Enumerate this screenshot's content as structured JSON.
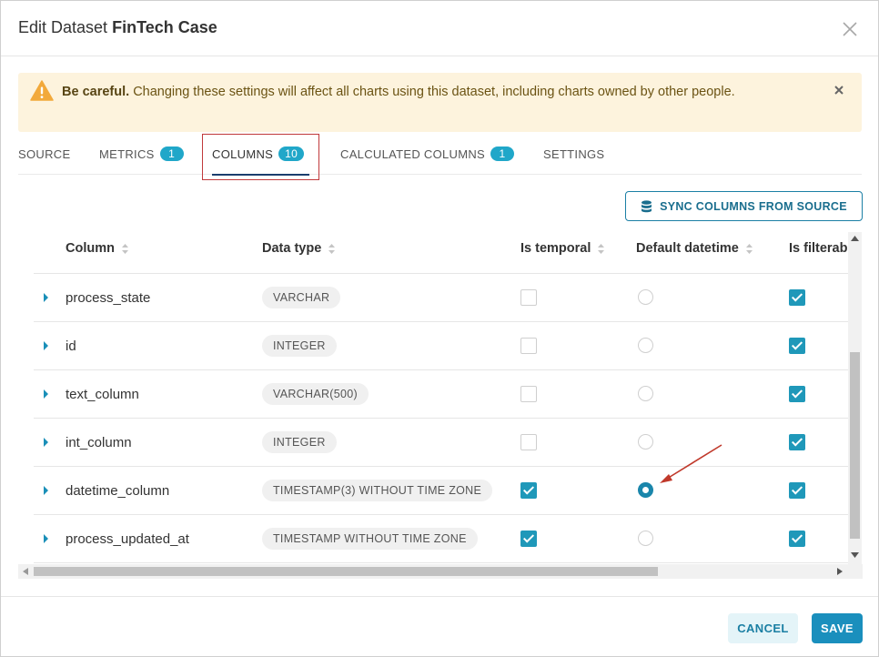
{
  "modal": {
    "title_prefix": "Edit Dataset",
    "title_name": "FinTech Case"
  },
  "alert": {
    "bold": "Be careful.",
    "message": "Changing these settings will affect all charts using this dataset, including charts owned by other people."
  },
  "tabs": [
    {
      "label": "SOURCE",
      "badge": ""
    },
    {
      "label": "METRICS",
      "badge": "1"
    },
    {
      "label": "COLUMNS",
      "badge": "10"
    },
    {
      "label": "CALCULATED COLUMNS",
      "badge": "1"
    },
    {
      "label": "SETTINGS",
      "badge": ""
    }
  ],
  "active_tab": "COLUMNS",
  "sync_button": "SYNC COLUMNS FROM SOURCE",
  "table": {
    "headers": [
      "Column",
      "Data type",
      "Is temporal",
      "Default datetime",
      "Is filterable"
    ],
    "rows": [
      {
        "name": "process_state",
        "type": "VARCHAR",
        "is_temporal": false,
        "default_datetime": false,
        "is_filterable": true
      },
      {
        "name": "id",
        "type": "INTEGER",
        "is_temporal": false,
        "default_datetime": false,
        "is_filterable": true
      },
      {
        "name": "text_column",
        "type": "VARCHAR(500)",
        "is_temporal": false,
        "default_datetime": false,
        "is_filterable": true
      },
      {
        "name": "int_column",
        "type": "INTEGER",
        "is_temporal": false,
        "default_datetime": false,
        "is_filterable": true
      },
      {
        "name": "datetime_column",
        "type": "TIMESTAMP(3) WITHOUT TIME ZONE",
        "is_temporal": true,
        "default_datetime": true,
        "is_filterable": true
      },
      {
        "name": "process_updated_at",
        "type": "TIMESTAMP WITHOUT TIME ZONE",
        "is_temporal": true,
        "default_datetime": false,
        "is_filterable": true
      }
    ]
  },
  "footer": {
    "cancel": "CANCEL",
    "save": "SAVE"
  },
  "colors": {
    "accent": "#1a8fbd",
    "badge": "#20a7c9",
    "alert_bg": "#fdf3dd",
    "warning": "#f2a93b",
    "annotation": "#c0392b"
  }
}
